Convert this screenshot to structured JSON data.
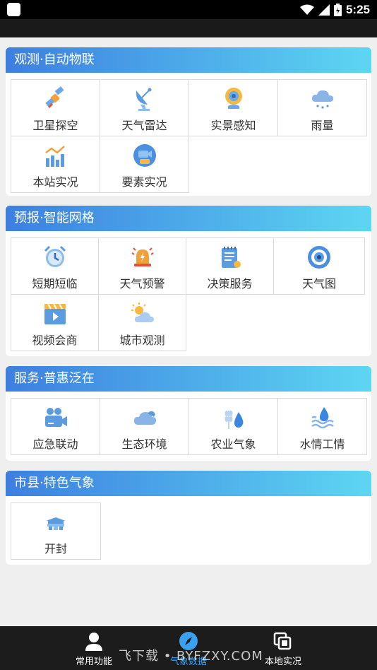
{
  "status_bar": {
    "time": "5:25"
  },
  "sections": [
    {
      "title": "观测·自动物联",
      "items": [
        {
          "label": "卫星探空",
          "icon": "satellite-icon"
        },
        {
          "label": "天气雷达",
          "icon": "radar-dish-icon"
        },
        {
          "label": "实景感知",
          "icon": "webcam-icon"
        },
        {
          "label": "雨量",
          "icon": "rain-cloud-icon"
        },
        {
          "label": "本站实况",
          "icon": "bar-chart-icon"
        },
        {
          "label": "要素实况",
          "icon": "video-2d-icon"
        }
      ]
    },
    {
      "title": "预报·智能网格",
      "items": [
        {
          "label": "短期短临",
          "icon": "alarm-clock-icon"
        },
        {
          "label": "天气预警",
          "icon": "warning-bell-icon"
        },
        {
          "label": "决策服务",
          "icon": "notepad-icon"
        },
        {
          "label": "天气图",
          "icon": "eye-target-icon"
        },
        {
          "label": "视频会商",
          "icon": "video-clapper-icon"
        },
        {
          "label": "城市观测",
          "icon": "sun-cloud-icon"
        }
      ]
    },
    {
      "title": "服务·普惠泛在",
      "items": [
        {
          "label": "应急联动",
          "icon": "video-camera-icon"
        },
        {
          "label": "生态环境",
          "icon": "cloud-icon"
        },
        {
          "label": "农业气象",
          "icon": "wheat-drop-icon"
        },
        {
          "label": "水情工情",
          "icon": "water-drop-waves-icon"
        }
      ]
    },
    {
      "title": "市县·特色气象",
      "items": [
        {
          "label": "开封",
          "icon": "gate-building-icon"
        }
      ]
    }
  ],
  "bottom_nav": [
    {
      "label": "常用功能",
      "icon": "person-icon",
      "active": false
    },
    {
      "label": "气象数据",
      "icon": "compass-icon",
      "active": true
    },
    {
      "label": "本地实况",
      "icon": "layers-icon",
      "active": false
    }
  ],
  "watermark": "飞下载 • BYFZXY.COM",
  "colors": {
    "header_start": "#3d7fe0",
    "header_end": "#5dd6f2",
    "active_nav": "#3aa0f0"
  }
}
